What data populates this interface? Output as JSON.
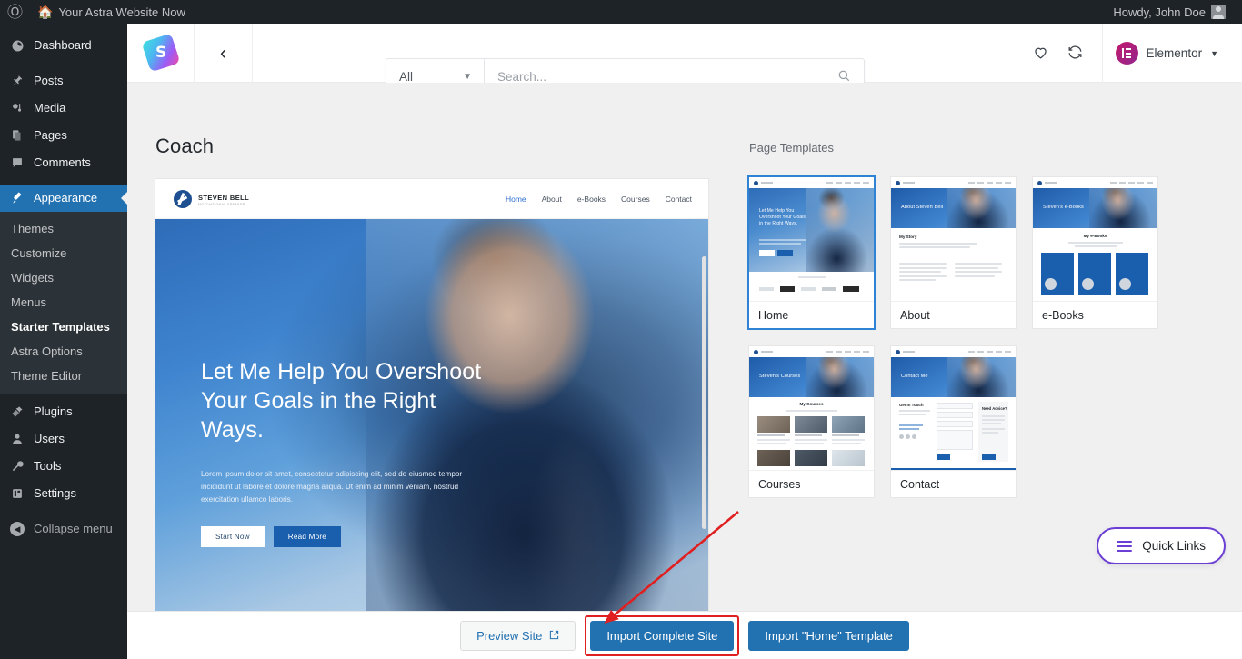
{
  "adminbar": {
    "wp_logo_icon": "wordpress-logo-icon",
    "home_icon": "home-icon",
    "site_name": "Your Astra Website Now",
    "howdy": "Howdy, John Doe",
    "avatar_icon": "avatar-icon"
  },
  "sidebar": {
    "items": [
      {
        "label": "Dashboard",
        "icon": "dashboard-icon",
        "glyph": "◉",
        "name": "dashboard"
      },
      {
        "label": "Posts",
        "icon": "pin-icon",
        "glyph": "✒",
        "name": "posts"
      },
      {
        "label": "Media",
        "icon": "media-icon",
        "glyph": "♫",
        "name": "media"
      },
      {
        "label": "Pages",
        "icon": "pages-icon",
        "glyph": "❐",
        "name": "pages"
      },
      {
        "label": "Comments",
        "icon": "comments-icon",
        "glyph": "▬",
        "name": "comments"
      },
      {
        "label": "Appearance",
        "icon": "paintbrush-icon",
        "glyph": "✎",
        "name": "appearance",
        "active": true
      },
      {
        "label": "Plugins",
        "icon": "plugin-icon",
        "glyph": "✈",
        "name": "plugins"
      },
      {
        "label": "Users",
        "icon": "users-icon",
        "glyph": "☻",
        "name": "users"
      },
      {
        "label": "Tools",
        "icon": "wrench-icon",
        "glyph": "⚒",
        "name": "tools"
      },
      {
        "label": "Settings",
        "icon": "settings-icon",
        "glyph": "⚙",
        "name": "settings"
      },
      {
        "label": "Collapse menu",
        "icon": "collapse-icon",
        "glyph": "◀",
        "name": "collapse-menu"
      }
    ],
    "submenu": [
      {
        "label": "Themes",
        "current": false
      },
      {
        "label": "Customize",
        "current": false
      },
      {
        "label": "Widgets",
        "current": false
      },
      {
        "label": "Menus",
        "current": false
      },
      {
        "label": "Starter Templates",
        "current": true
      },
      {
        "label": "Astra Options",
        "current": false
      },
      {
        "label": "Theme Editor",
        "current": false
      }
    ]
  },
  "topbar": {
    "logo_icon": "starter-templates-logo-icon",
    "logo_letter": "S",
    "back_icon": "chevron-left-icon",
    "filter_value": "All",
    "filter_caret": "▼",
    "search_value": "",
    "search_placeholder": "Search...",
    "search_icon": "search-icon",
    "favorite_icon": "heart-icon",
    "sync_icon": "sync-icon",
    "builder_label": "Elementor",
    "builder_icon": "elementor-logo-icon",
    "builder_caret": "▼"
  },
  "main": {
    "page_title": "Coach",
    "templates_label": "Page Templates"
  },
  "preview": {
    "brand_name": "STEVEN BELL",
    "brand_tagline": "MOTIVATIONAL SPEAKER",
    "logo_icon": "steven-bell-logo-icon",
    "nav": [
      "Home",
      "About",
      "e-Books",
      "Courses",
      "Contact"
    ],
    "active_nav": "Home",
    "headline": "Let Me Help You Overshoot Your Goals in the Right Ways.",
    "body": "Lorem ipsum dolor sit amet, consectetur adipiscing elit, sed do eiusmod tempor incididunt ut labore et dolore magna aliqua. Ut enim ad minim veniam, nostrud exercitation ullamco laboris.",
    "primary_button": "Start Now",
    "secondary_button": "Read More"
  },
  "templates": [
    {
      "label": "Home",
      "selected": true,
      "banner_title": "Let Me Help You Overshoot Your Goals in the Right Ways."
    },
    {
      "label": "About",
      "selected": false,
      "banner_title": "About Steven Bell"
    },
    {
      "label": "e-Books",
      "selected": false,
      "banner_title": "Steven's e-Books"
    },
    {
      "label": "Courses",
      "selected": false,
      "banner_title": "Steven's Courses"
    },
    {
      "label": "Contact",
      "selected": false,
      "banner_title": "Contact Me"
    }
  ],
  "template_sections": {
    "about_heading": "My Story",
    "ebooks_heading": "My e-Books",
    "courses_heading": "My Courses",
    "contact_heading": "Get In Touch",
    "contact_aside": "Need Advice?"
  },
  "bottombar": {
    "preview_site": "Preview Site",
    "preview_icon": "external-link-icon",
    "import_complete": "Import Complete Site",
    "import_template": "Import \"Home\" Template"
  },
  "quick_links": {
    "label": "Quick Links",
    "icon": "hamburger-icon"
  },
  "annotation": {
    "type": "arrow",
    "color": "#e02020",
    "points_to": "Import Complete Site"
  },
  "colors": {
    "wp_dark": "#1d2327",
    "wp_blue": "#2271b1",
    "accent_purple": "#6b3fd4",
    "annotation_red": "#e02020",
    "site_blue": "#1a5fae"
  }
}
